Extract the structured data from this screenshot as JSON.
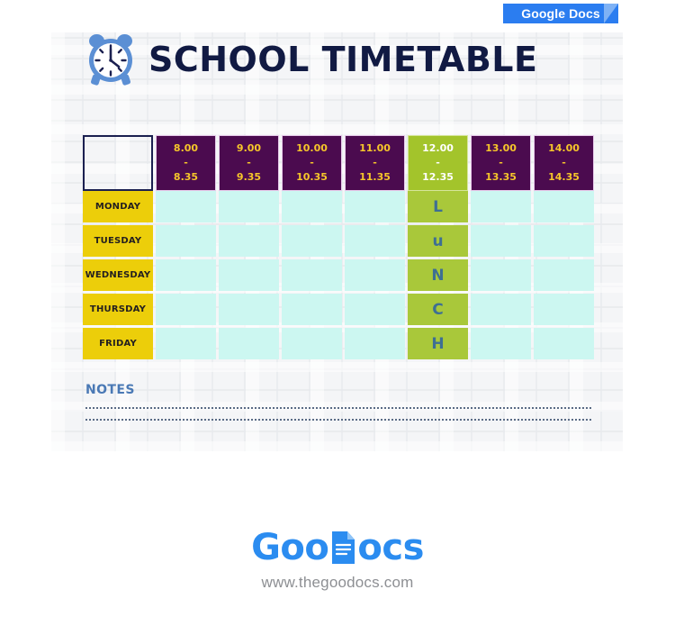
{
  "badge": {
    "label": "Google Docs",
    "bg_color": "#2b7df0",
    "fold_color": "#7fb2f5"
  },
  "document": {
    "title": "SCHOOL TIMETABLE",
    "clock_icon": "alarm-clock-icon",
    "background_color": "#f4f5f7"
  },
  "timetable": {
    "corner_label": "",
    "time_slots": [
      {
        "start": "8.00",
        "separator": "-",
        "end": "8.35",
        "is_lunch": false
      },
      {
        "start": "9.00",
        "separator": "-",
        "end": "9.35",
        "is_lunch": false
      },
      {
        "start": "10.00",
        "separator": "-",
        "end": "10.35",
        "is_lunch": false
      },
      {
        "start": "11.00",
        "separator": "-",
        "end": "11.35",
        "is_lunch": false
      },
      {
        "start": "12.00",
        "separator": "-",
        "end": "12.35",
        "is_lunch": true
      },
      {
        "start": "13.00",
        "separator": "-",
        "end": "13.35",
        "is_lunch": false
      },
      {
        "start": "14.00",
        "separator": "-",
        "end": "14.35",
        "is_lunch": false
      }
    ],
    "days": [
      {
        "label": "MONDAY",
        "lunch_letter": "L"
      },
      {
        "label": "TUESDAY",
        "lunch_letter": "u"
      },
      {
        "label": "WEDNESDAY",
        "lunch_letter": "N"
      },
      {
        "label": "THURSDAY",
        "lunch_letter": "C"
      },
      {
        "label": "FRIDAY",
        "lunch_letter": "H"
      }
    ],
    "lunch_column_index": 4,
    "lunch_word": "LuNCH",
    "colors": {
      "header_purple": "#4b0b4f",
      "header_text_gold": "#f6c62a",
      "lunch_green": "#a3c42b",
      "day_yellow": "#ecce0a",
      "day_text": "#231f20",
      "empty_cell_cyan": "#ccf7f1",
      "lunch_letter_blue": "#3e6f93",
      "corner_border_navy": "#1b2050",
      "title_navy": "#111a43"
    }
  },
  "notes": {
    "label": "NOTES",
    "label_color": "#4a79b5",
    "line_count": 2,
    "lines": [
      "",
      ""
    ]
  },
  "footer": {
    "brand_part1": "Goo",
    "brand_part2": "ocs",
    "brand_icon": "document-icon",
    "url": "www.thegoodocs.com",
    "brand_color": "#2b8cf0",
    "url_color": "#8d8f93"
  }
}
